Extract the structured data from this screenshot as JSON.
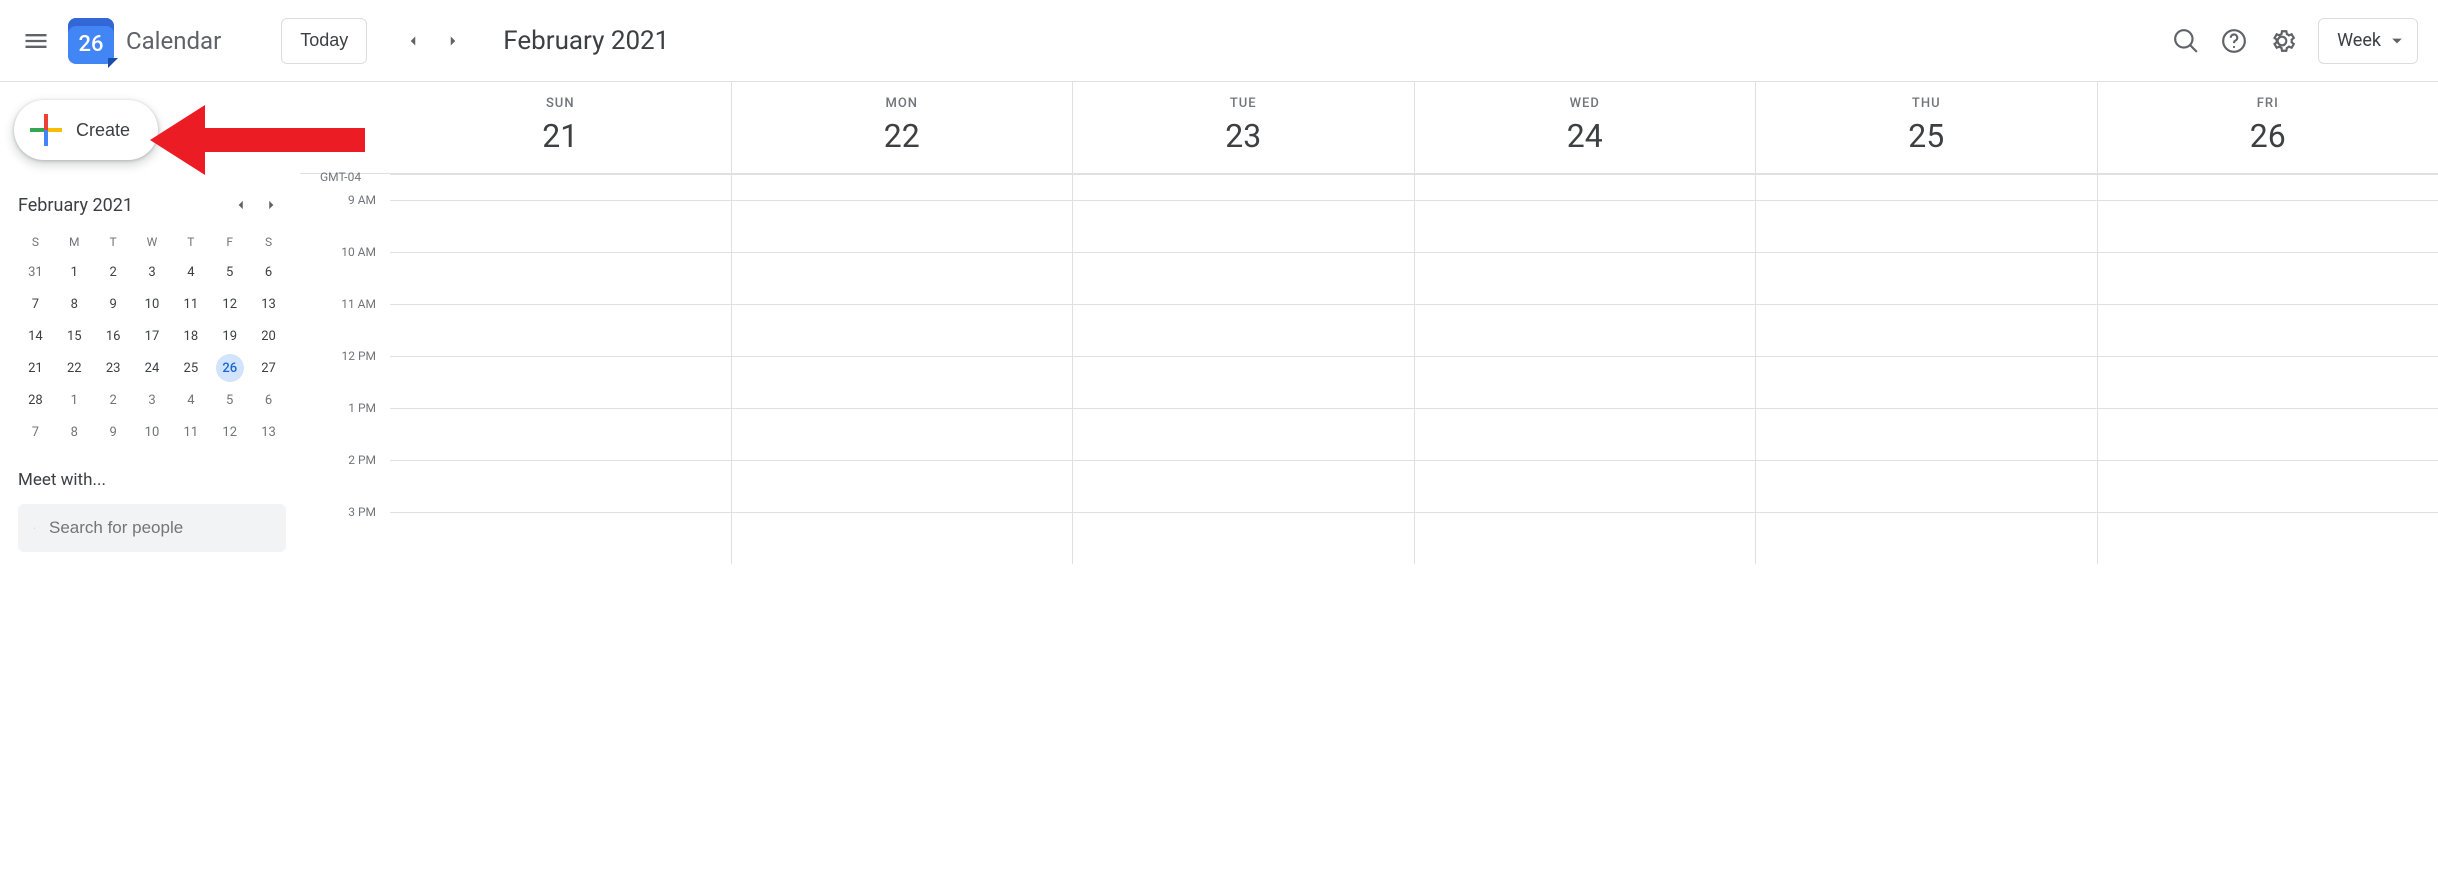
{
  "header": {
    "logo_day": "26",
    "app_title": "Calendar",
    "today_label": "Today",
    "current_range": "February 2021",
    "view_label": "Week"
  },
  "sidebar": {
    "create_label": "Create",
    "mini_title": "February 2021",
    "dow": [
      "S",
      "M",
      "T",
      "W",
      "T",
      "F",
      "S"
    ],
    "weeks": [
      [
        {
          "d": "31",
          "o": true
        },
        {
          "d": "1"
        },
        {
          "d": "2"
        },
        {
          "d": "3"
        },
        {
          "d": "4"
        },
        {
          "d": "5"
        },
        {
          "d": "6"
        }
      ],
      [
        {
          "d": "7"
        },
        {
          "d": "8"
        },
        {
          "d": "9"
        },
        {
          "d": "10"
        },
        {
          "d": "11"
        },
        {
          "d": "12"
        },
        {
          "d": "13"
        }
      ],
      [
        {
          "d": "14"
        },
        {
          "d": "15"
        },
        {
          "d": "16"
        },
        {
          "d": "17"
        },
        {
          "d": "18"
        },
        {
          "d": "19"
        },
        {
          "d": "20"
        }
      ],
      [
        {
          "d": "21"
        },
        {
          "d": "22"
        },
        {
          "d": "23"
        },
        {
          "d": "24"
        },
        {
          "d": "25"
        },
        {
          "d": "26",
          "t": true
        },
        {
          "d": "27"
        }
      ],
      [
        {
          "d": "28"
        },
        {
          "d": "1",
          "o": true
        },
        {
          "d": "2",
          "o": true
        },
        {
          "d": "3",
          "o": true
        },
        {
          "d": "4",
          "o": true
        },
        {
          "d": "5",
          "o": true
        },
        {
          "d": "6",
          "o": true
        }
      ],
      [
        {
          "d": "7",
          "o": true
        },
        {
          "d": "8",
          "o": true
        },
        {
          "d": "9",
          "o": true
        },
        {
          "d": "10",
          "o": true
        },
        {
          "d": "11",
          "o": true
        },
        {
          "d": "12",
          "o": true
        },
        {
          "d": "13",
          "o": true
        }
      ]
    ],
    "meet_title": "Meet with...",
    "search_placeholder": "Search for people"
  },
  "grid": {
    "timezone": "GMT-04",
    "days": [
      {
        "dow": "SUN",
        "dom": "21"
      },
      {
        "dow": "MON",
        "dom": "22"
      },
      {
        "dow": "TUE",
        "dom": "23"
      },
      {
        "dow": "WED",
        "dom": "24"
      },
      {
        "dow": "THU",
        "dom": "25"
      },
      {
        "dow": "FRI",
        "dom": "26"
      }
    ],
    "hours": [
      "9 AM",
      "10 AM",
      "11 AM",
      "12 PM",
      "1 PM",
      "2 PM",
      "3 PM"
    ]
  }
}
